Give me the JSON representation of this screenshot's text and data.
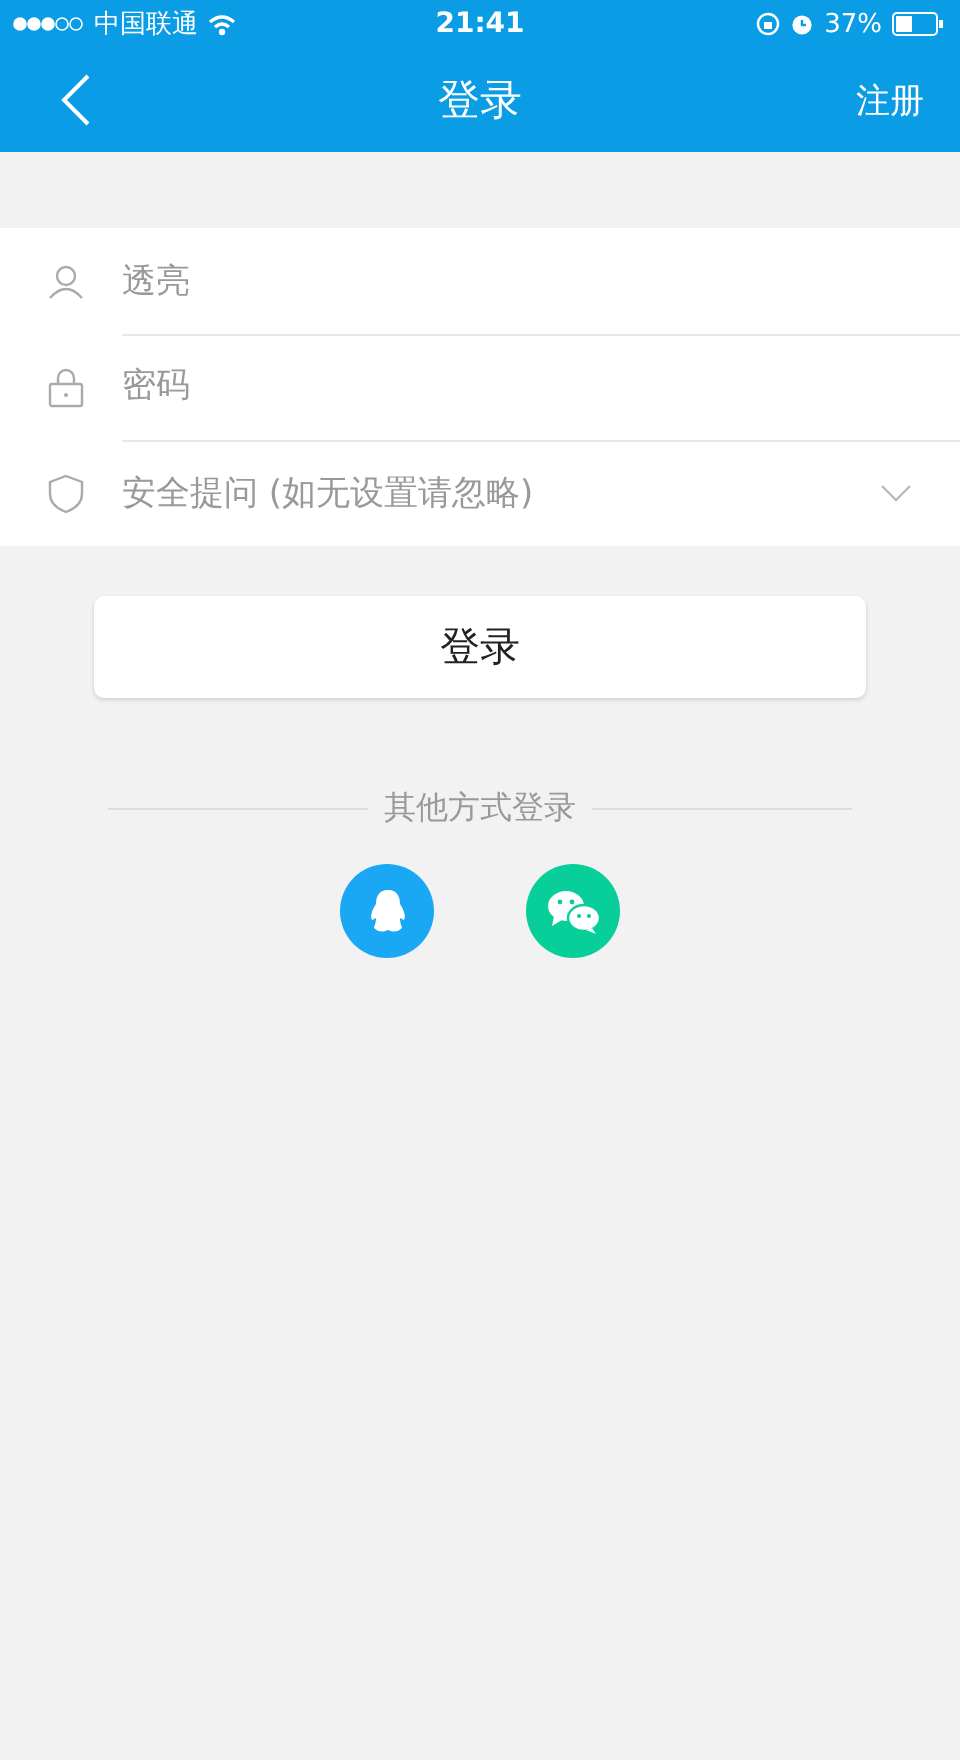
{
  "status_bar": {
    "carrier": "中国联通",
    "time": "21:41",
    "battery": "37%"
  },
  "nav": {
    "title": "登录",
    "action": "注册"
  },
  "fields": [
    {
      "kind": "user",
      "value": "透亮"
    },
    {
      "kind": "password",
      "placeholder": "密码"
    },
    {
      "kind": "question",
      "placeholder": "安全提问 (如无设置请忽略)"
    }
  ],
  "login_button": "登录",
  "other_login": {
    "label": "其他方式登录",
    "options": [
      {
        "kind": "qq"
      },
      {
        "kind": "wechat"
      }
    ]
  }
}
